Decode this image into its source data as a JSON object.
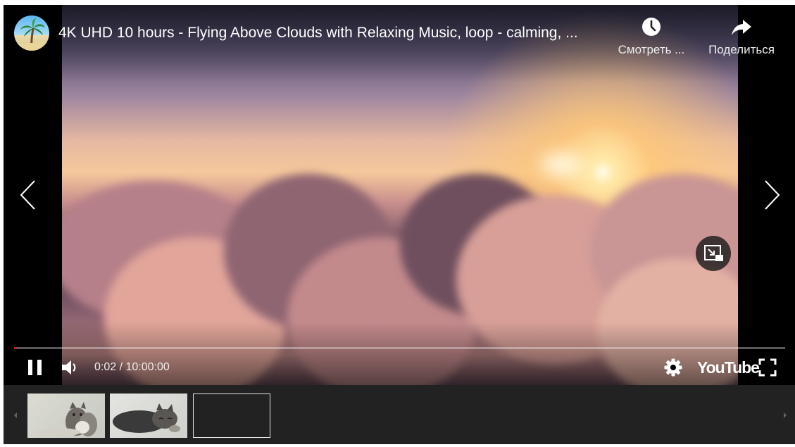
{
  "player": {
    "title": "4K UHD 10 hours - Flying Above Clouds with Relaxing Music, loop - calming, ...",
    "watch_later_label": "Смотреть ...",
    "share_label": "Поделиться",
    "time_display": "0:02 / 10:00:00",
    "logo_text": "YouTube",
    "progress_fraction": 0.0001,
    "icons": [
      "channel-avatar",
      "clock-icon",
      "share-icon",
      "chevron-left-icon",
      "chevron-right-icon",
      "miniplayer-icon",
      "pause-icon",
      "volume-icon",
      "gear-icon",
      "fullscreen-icon"
    ]
  },
  "strip": {
    "items": [
      {
        "name": "kitten-thumbnail-1",
        "kind": "image"
      },
      {
        "name": "kitten-thumbnail-2",
        "kind": "image"
      },
      {
        "name": "empty-thumbnail",
        "kind": "empty"
      }
    ]
  },
  "colors": {
    "player_bg": "#000000",
    "strip_bg": "#222222",
    "progress_played": "#ff0000"
  }
}
